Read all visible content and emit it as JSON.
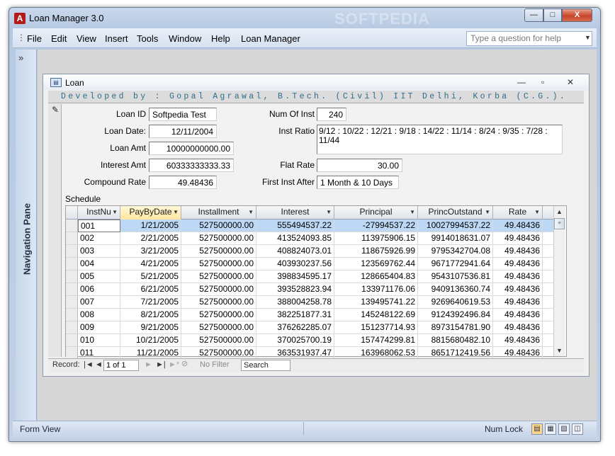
{
  "app": {
    "title": "Loan Manager 3.0",
    "icon_letter": "A",
    "watermark": "SOFTPEDIA"
  },
  "caption_buttons": {
    "minimize": "—",
    "maximize": "□",
    "close": "X"
  },
  "menu": {
    "items": [
      {
        "label": "File"
      },
      {
        "label": "Edit"
      },
      {
        "label": "View"
      },
      {
        "label": "Insert"
      },
      {
        "label": "Tools"
      },
      {
        "label": "Window"
      },
      {
        "label": "Help"
      },
      {
        "label": "Loan Manager"
      }
    ],
    "help_placeholder": "Type a question for help"
  },
  "nav_pane": {
    "label": "Navigation Pane",
    "chevron": "»"
  },
  "form": {
    "title": "Loan",
    "header": "Developed by : Gopal Agrawal, B.Tech. (Civil)  IIT Delhi, Korba (C.G.).",
    "fields": {
      "loan_id": {
        "label": "Loan ID",
        "value": "Softpedia Test"
      },
      "loan_date": {
        "label": "Loan Date:",
        "value": "12/11/2004"
      },
      "loan_amt": {
        "label": "Loan Amt",
        "value": "10000000000.00"
      },
      "interest_amt": {
        "label": "Interest Amt",
        "value": "60333333333.33"
      },
      "compound_rate": {
        "label": "Compound Rate",
        "value": "49.48436"
      },
      "num_of_inst": {
        "label": "Num Of Inst",
        "value": "240"
      },
      "inst_ratio": {
        "label": "Inst Ratio",
        "value": "9/12 : 10/22 : 12/21 : 9/18 : 14/22 : 11/14 : 8/24 : 9/35 : 7/28 : 11/44"
      },
      "flat_rate": {
        "label": "Flat Rate",
        "value": "30.00"
      },
      "first_inst_after": {
        "label": "First Inst After",
        "value": "1 Month & 10 Days"
      }
    },
    "schedule_label": "Schedule",
    "schedule": {
      "columns": [
        "InstNu",
        "PayByDate",
        "Installment",
        "Interest",
        "Principal",
        "PrincOutstand",
        "Rate"
      ],
      "rows": [
        [
          "001",
          "1/21/2005",
          "527500000.00",
          "555494537.22",
          "-27994537.22",
          "10027994537.22",
          "49.48436"
        ],
        [
          "002",
          "2/21/2005",
          "527500000.00",
          "413524093.85",
          "113975906.15",
          "9914018631.07",
          "49.48436"
        ],
        [
          "003",
          "3/21/2005",
          "527500000.00",
          "408824073.01",
          "118675926.99",
          "9795342704.08",
          "49.48436"
        ],
        [
          "004",
          "4/21/2005",
          "527500000.00",
          "403930237.56",
          "123569762.44",
          "9671772941.64",
          "49.48436"
        ],
        [
          "005",
          "5/21/2005",
          "527500000.00",
          "398834595.17",
          "128665404.83",
          "9543107536.81",
          "49.48436"
        ],
        [
          "006",
          "6/21/2005",
          "527500000.00",
          "393528823.94",
          "133971176.06",
          "9409136360.74",
          "49.48436"
        ],
        [
          "007",
          "7/21/2005",
          "527500000.00",
          "388004258.78",
          "139495741.22",
          "9269640619.53",
          "49.48436"
        ],
        [
          "008",
          "8/21/2005",
          "527500000.00",
          "382251877.31",
          "145248122.69",
          "9124392496.84",
          "49.48436"
        ],
        [
          "009",
          "9/21/2005",
          "527500000.00",
          "376262285.07",
          "151237714.93",
          "8973154781.90",
          "49.48436"
        ],
        [
          "010",
          "10/21/2005",
          "527500000.00",
          "370025700.19",
          "157474299.81",
          "8815680482.10",
          "49.48436"
        ],
        [
          "011",
          "11/21/2005",
          "527500000.00",
          "363531937.47",
          "163968062.53",
          "8651712419.56",
          "49.48436"
        ]
      ]
    },
    "record_nav": {
      "label": "Record:",
      "first": "|◄",
      "prev": "◄",
      "current": "1 of 1",
      "next": "►",
      "last": "►|",
      "new": "►*",
      "no_filter": "No Filter",
      "search": "Search"
    }
  },
  "status": {
    "left": "Form View",
    "right": "Num Lock"
  },
  "colors": {
    "header_text": "#2d6d8e",
    "selected_row": "#bcd8f4",
    "close_button": "#c7452b"
  }
}
